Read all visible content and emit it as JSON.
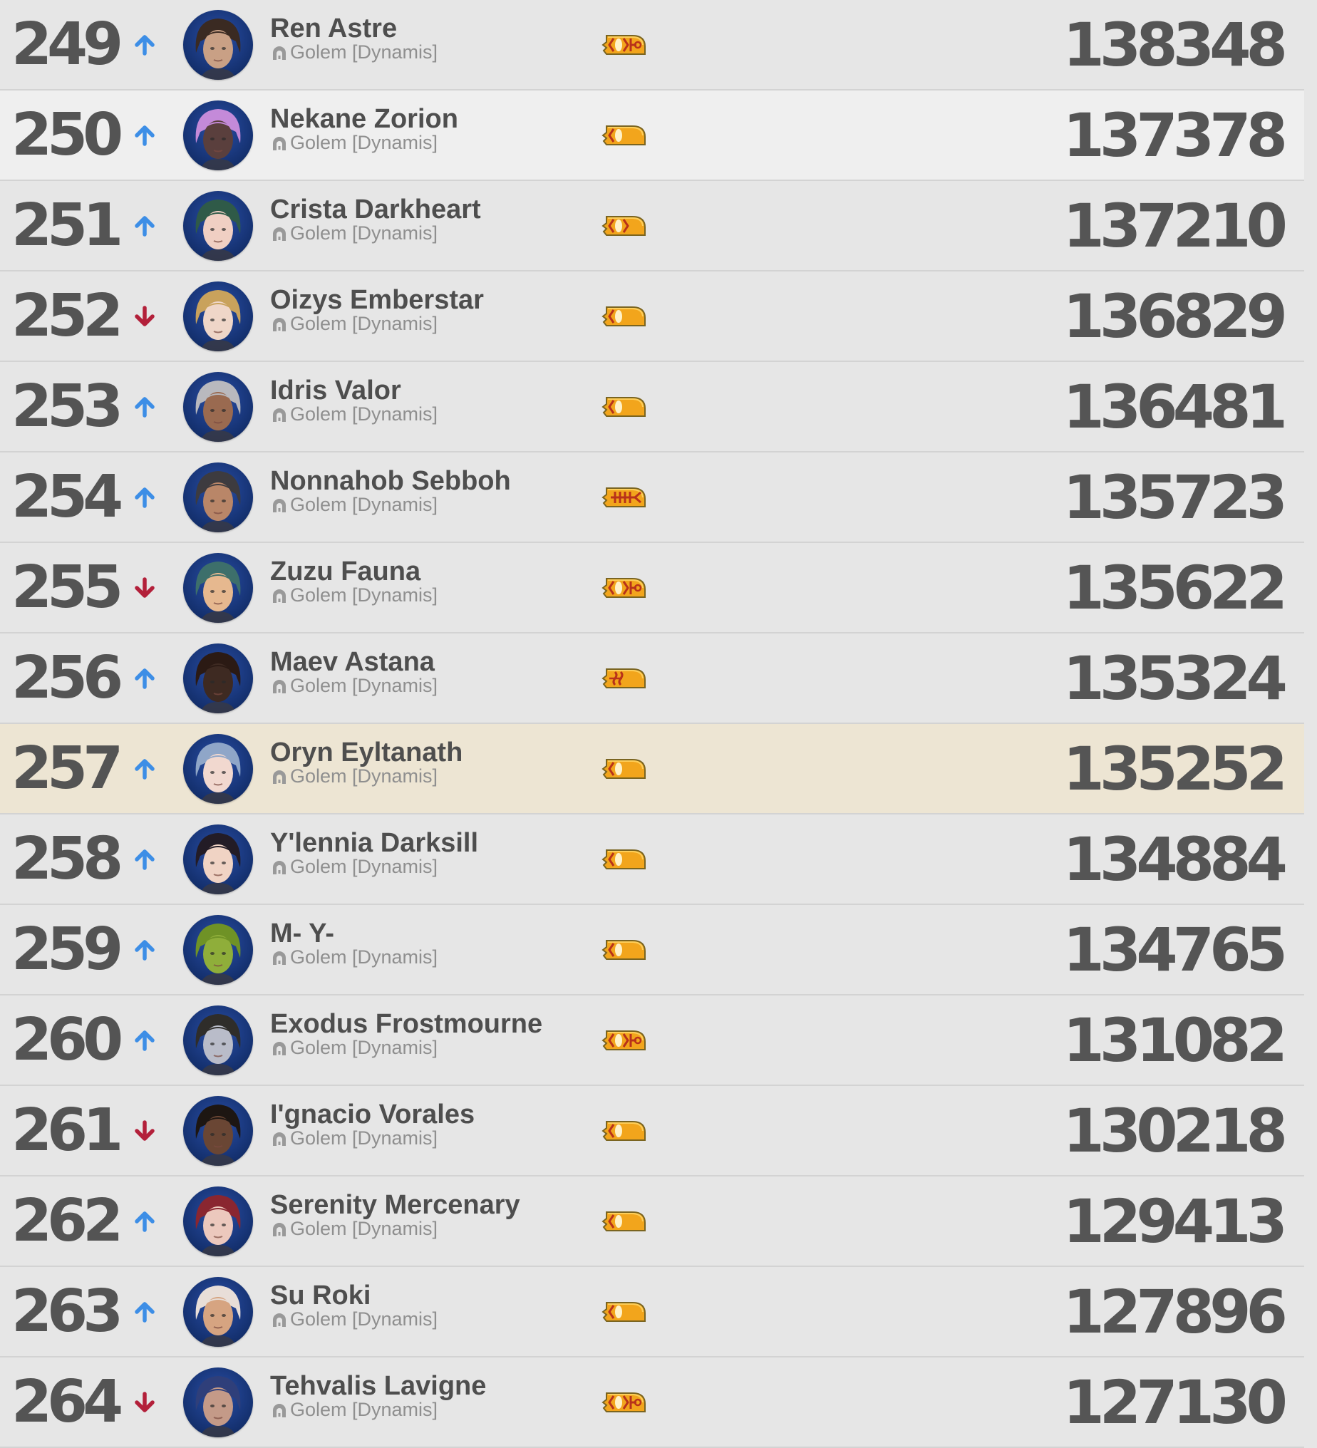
{
  "colors": {
    "row_background": "#e6e6e6",
    "row_hover_background": "#efefef",
    "row_self_background": "#ede5d3",
    "separator": "#d3d3d3",
    "text_primary": "#4e4e4e",
    "text_secondary": "#8f8f8f",
    "trend_up": "#3d8ee6",
    "trend_down": "#b3203a",
    "badge_gold": "#f2a51c",
    "badge_red": "#b8321a"
  },
  "leaderboard": {
    "rows": [
      {
        "rank": "249",
        "trend": "up",
        "name": "Ren Astre",
        "world": "Golem [Dynamis]",
        "badge": "full",
        "score": "138348",
        "state": "normal",
        "avatar": {
          "skin": "#c9a085",
          "hair": "#3a2a22"
        }
      },
      {
        "rank": "250",
        "trend": "up",
        "name": "Nekane Zorion",
        "world": "Golem [Dynamis]",
        "badge": "plain",
        "score": "137378",
        "state": "hover",
        "avatar": {
          "skin": "#5a3f3d",
          "hair": "#c48ad9"
        }
      },
      {
        "rank": "251",
        "trend": "up",
        "name": "Crista Darkheart",
        "world": "Golem [Dynamis]",
        "badge": "chevrons",
        "score": "137210",
        "state": "normal",
        "avatar": {
          "skin": "#f0cfc3",
          "hair": "#2f5a48"
        }
      },
      {
        "rank": "252",
        "trend": "down",
        "name": "Oizys Emberstar",
        "world": "Golem [Dynamis]",
        "badge": "plain",
        "score": "136829",
        "state": "normal",
        "avatar": {
          "skin": "#efd6c8",
          "hair": "#c9a25c"
        }
      },
      {
        "rank": "253",
        "trend": "up",
        "name": "Idris Valor",
        "world": "Golem [Dynamis]",
        "badge": "plain",
        "score": "136481",
        "state": "normal",
        "avatar": {
          "skin": "#9a6a50",
          "hair": "#b9b9be"
        }
      },
      {
        "rank": "254",
        "trend": "up",
        "name": "Nonnahob Sebboh",
        "world": "Golem [Dynamis]",
        "badge": "fishbone",
        "score": "135723",
        "state": "normal",
        "avatar": {
          "skin": "#b98668",
          "hair": "#3d3b3f"
        }
      },
      {
        "rank": "255",
        "trend": "down",
        "name": "Zuzu Fauna",
        "world": "Golem [Dynamis]",
        "badge": "full",
        "score": "135622",
        "state": "normal",
        "avatar": {
          "skin": "#e6b88f",
          "hair": "#3d6f6b"
        }
      },
      {
        "rank": "256",
        "trend": "up",
        "name": "Maev Astana",
        "world": "Golem [Dynamis]",
        "badge": "waves",
        "score": "135324",
        "state": "normal",
        "avatar": {
          "skin": "#3e2a22",
          "hair": "#2b1a14"
        }
      },
      {
        "rank": "257",
        "trend": "up",
        "name": "Oryn Eyltanath",
        "world": "Golem [Dynamis]",
        "badge": "plain",
        "score": "135252",
        "state": "self",
        "avatar": {
          "skin": "#f1d8cf",
          "hair": "#8fa6c8"
        }
      },
      {
        "rank": "258",
        "trend": "up",
        "name": "Y'lennia Darksill",
        "world": "Golem [Dynamis]",
        "badge": "plain",
        "score": "134884",
        "state": "normal",
        "avatar": {
          "skin": "#f0d3c4",
          "hair": "#231c26"
        }
      },
      {
        "rank": "259",
        "trend": "up",
        "name": "M- Y-",
        "world": "Golem [Dynamis]",
        "badge": "plain",
        "score": "134765",
        "state": "normal",
        "avatar": {
          "skin": "#8fae3a",
          "hair": "#6f9226"
        }
      },
      {
        "rank": "260",
        "trend": "up",
        "name": "Exodus Frostmourne",
        "world": "Golem [Dynamis]",
        "badge": "full",
        "score": "131082",
        "state": "normal",
        "avatar": {
          "skin": "#b9bcc9",
          "hair": "#2f2d2a"
        }
      },
      {
        "rank": "261",
        "trend": "down",
        "name": "I'gnacio Vorales",
        "world": "Golem [Dynamis]",
        "badge": "plain",
        "score": "130218",
        "state": "normal",
        "avatar": {
          "skin": "#6a4634",
          "hair": "#1d1612"
        }
      },
      {
        "rank": "262",
        "trend": "up",
        "name": "Serenity Mercenary",
        "world": "Golem [Dynamis]",
        "badge": "plain",
        "score": "129413",
        "state": "normal",
        "avatar": {
          "skin": "#ecc8bd",
          "hair": "#8a2630"
        }
      },
      {
        "rank": "263",
        "trend": "up",
        "name": "Su Roki",
        "world": "Golem [Dynamis]",
        "badge": "plain",
        "score": "127896",
        "state": "normal",
        "avatar": {
          "skin": "#d6a481",
          "hair": "#e8ded8"
        }
      },
      {
        "rank": "264",
        "trend": "down",
        "name": "Tehvalis Lavigne",
        "world": "Golem [Dynamis]",
        "badge": "full",
        "score": "127130",
        "state": "normal",
        "avatar": {
          "skin": "#c49a88",
          "hair": "#2f3f7a"
        }
      }
    ]
  }
}
